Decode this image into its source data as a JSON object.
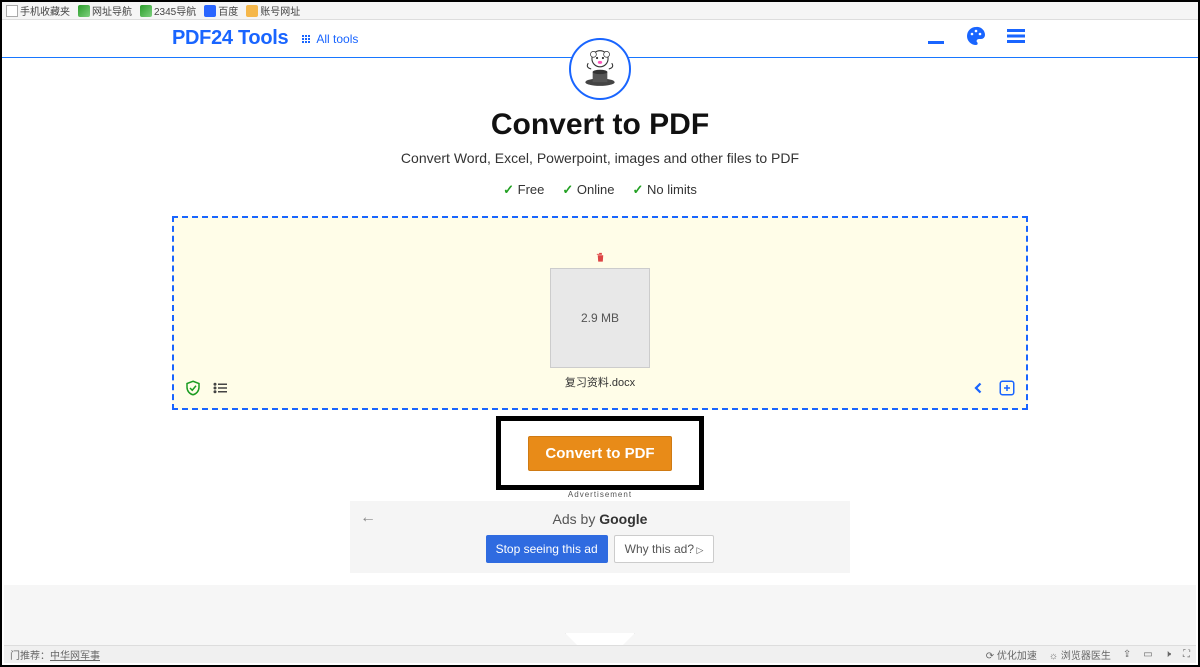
{
  "browser": {
    "favorites": [
      "手机收藏夹",
      "网址导航",
      "2345导航",
      "百度",
      "账号网址"
    ]
  },
  "header": {
    "brand": "PDF24 Tools",
    "all_tools": "All tools"
  },
  "page": {
    "title": "Convert to PDF",
    "subtitle": "Convert Word, Excel, Powerpoint, images and other files to PDF",
    "features": [
      "Free",
      "Online",
      "No limits"
    ]
  },
  "file": {
    "size": "2.9 MB",
    "name": "复习资料.docx"
  },
  "action": {
    "convert_label": "Convert to PDF"
  },
  "ad": {
    "label": "Advertisement",
    "by": "Ads by ",
    "by_brand": "Google",
    "stop": "Stop seeing this ad",
    "why": "Why this ad?"
  },
  "footer": {
    "left_prefix": "门推荐：",
    "left_link": "中华网军事",
    "right": [
      "优化加速",
      "浏览器医生"
    ]
  }
}
